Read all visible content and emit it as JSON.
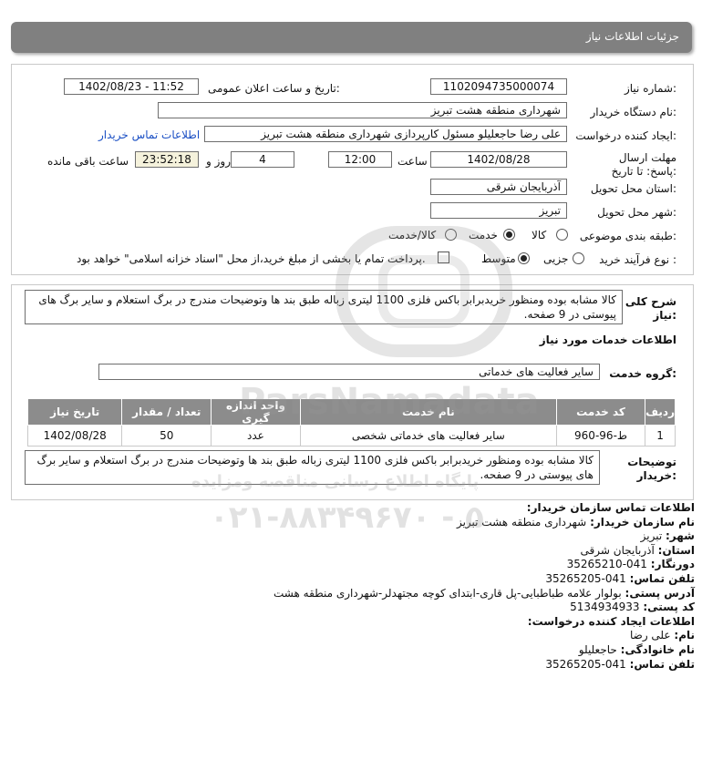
{
  "header": {
    "title": "جزئیات اطلاعات نیاز"
  },
  "form": {
    "need_number_label": "شماره نیاز:",
    "need_number": "1102094735000074",
    "announce_label": "تاریخ و ساعت اعلان عمومی:",
    "announce_value": "1402/08/23 - 11:52",
    "buyer_org_label": "نام دستگاه خریدار:",
    "buyer_org": "شهرداری منطقه هشت تبریز",
    "creator_label": "ایجاد کننده درخواست:",
    "creator": "علی رضا حاجعلیلو مسئول کارپردازی شهرداری منطقه هشت تبریز",
    "contact_link": "اطلاعات تماس خریدار",
    "deadline_label": "مهلت ارسال پاسخ: تا تاریخ:",
    "deadline_date": "1402/08/28",
    "time_label": "ساعت",
    "deadline_time": "12:00",
    "days_value": "4",
    "days_label": "روز و",
    "remaining_time": "23:52:18",
    "remaining_label": "ساعت باقی مانده",
    "province_label": "استان محل تحویل:",
    "province": "آذربایجان شرقی",
    "city_label": "شهر محل تحویل:",
    "city": "تبریز",
    "category_label": "طبقه بندی موضوعی:",
    "category_options": [
      "کالا",
      "خدمت",
      "کالا/خدمت"
    ],
    "category_selected": "خدمت",
    "process_label": "نوع فرآیند خرید :",
    "process_options": [
      "جزیی",
      "متوسط"
    ],
    "process_selected": "متوسط",
    "payment_note": "پرداخت تمام یا بخشی از مبلغ خرید،از محل \"اسناد خزانه اسلامی\" خواهد بود."
  },
  "summary": {
    "label": "شرح کلی نیاز:",
    "text": "کالا مشابه بوده ومنظور خریدبرابر باکس فلزی 1100 لیتری زباله طبق بند ها وتوضیحات مندرج در برگ استعلام و سایر برگ های پیوستی در 9 صفحه."
  },
  "services": {
    "section_title": "اطلاعات خدمات مورد نیاز",
    "group_label": "گروه خدمت:",
    "group_value": "سایر فعالیت های خدماتی",
    "table": {
      "headers": [
        "ردیف",
        "کد خدمت",
        "نام خدمت",
        "واحد اندازه گیری",
        "تعداد / مقدار",
        "تاریخ نیاز"
      ],
      "rows": [
        [
          "1",
          "ط-96-960",
          "سایر فعالیت های خدماتی شخصی",
          "عدد",
          "50",
          "1402/08/28"
        ]
      ]
    }
  },
  "buyer_notes": {
    "label": "توضیحات خریدار:",
    "text": "کالا مشابه بوده ومنظور خریدبرابر باکس فلزی 1100 لیتری زباله طبق بند ها وتوضیحات مندرج در برگ استعلام و سایر برگ های پیوستی در 9 صفحه."
  },
  "contact": {
    "title": "اطلاعات تماس سازمان خریدار:",
    "org_label": "نام سازمان خریدار:",
    "org": "شهرداری منطقه هشت تبریز",
    "city_label": "شهر:",
    "city": "تبریز",
    "province_label": "استان:",
    "province": "آذربایجان شرقی",
    "fax_label": "دورنگار:",
    "fax": "041-35265210",
    "phone_label": "تلفن تماس:",
    "phone": "041-35265205",
    "address_label": "آدرس پستی:",
    "address": "بولوار علامه طباطبایی-پل قاری-ابتدای کوچه مجتهدلر-شهرداری منطقه هشت",
    "postal_label": "کد پستی:",
    "postal": "5134934933",
    "creator_title": "اطلاعات ایجاد کننده درخواست:",
    "name_label": "نام:",
    "name": "علی رضا",
    "family_label": "نام خانوادگی:",
    "family": "حاجعلیلو",
    "phone2_label": "تلفن تماس:",
    "phone2": "041-35265205"
  },
  "watermark": {
    "brand": "ParsNamadata",
    "subtitle": "پایگاه اطلاع رسانی مناقصه ومزایده",
    "phone": "۰۲۱-۸۸۳۴۹۶۷۰ - ۵"
  }
}
